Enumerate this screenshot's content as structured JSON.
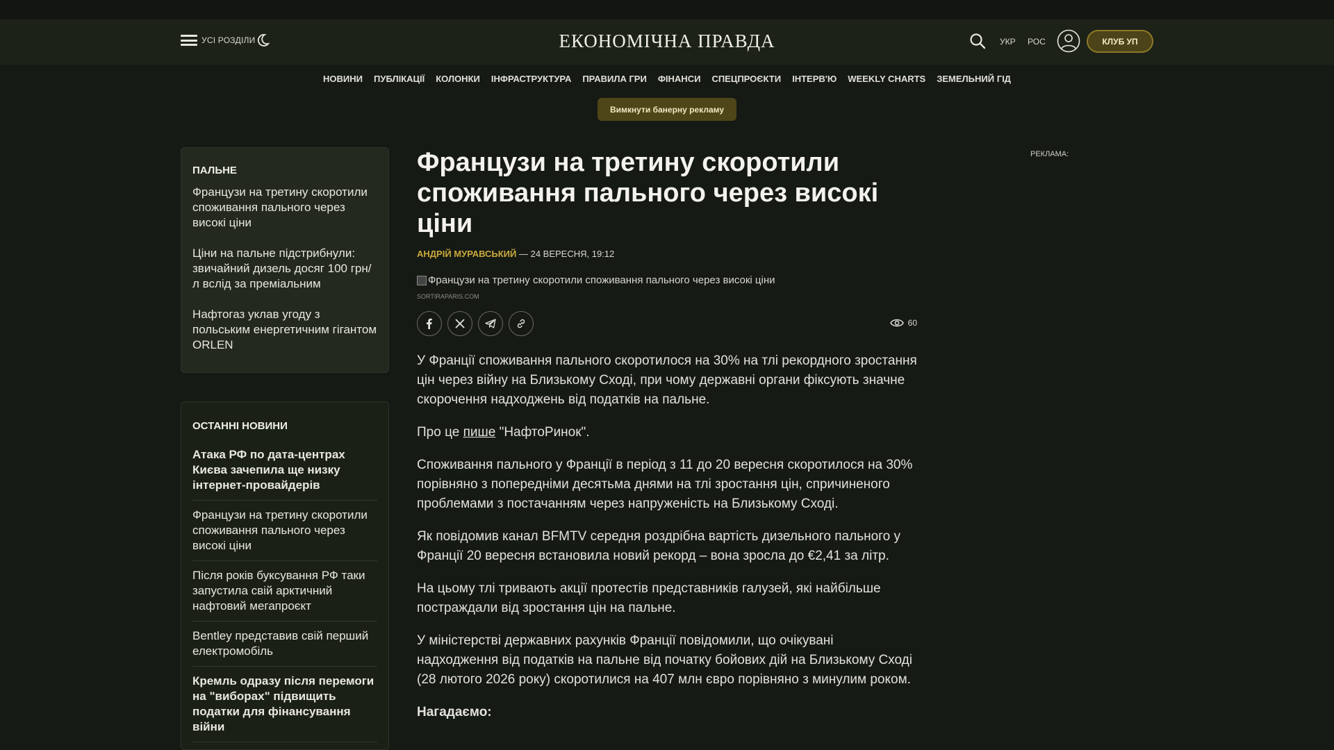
{
  "header": {
    "menu_label": "УСІ РОЗДІЛИ",
    "logo": "ЕКОНОМІЧНА ПРАВДА",
    "lang_ukr": "УКР",
    "lang_ros": "РОС",
    "club_button": "КЛУБ УП"
  },
  "nav": {
    "items": [
      "НОВИНИ",
      "ПУБЛІКАЦІЇ",
      "КОЛОНКИ",
      "ІНФРАСТРУКТУРА",
      "ПРАВИЛА ГРИ",
      "ФІНАНСИ",
      "СПЕЦПРОЄКТИ",
      "ІНТЕРВ'Ю",
      "WEEKLY CHARTS",
      "ЗЕМЕЛЬНИЙ ГІД"
    ]
  },
  "ad_toggle": "Вимкнути банерну рекламу",
  "fuel_box": {
    "title": "ПАЛЬНЕ",
    "links": [
      "Французи на третину скоротили споживання пального через високі ціни",
      "Ціни на пальне підстрибнули: звичайний дизель досяг 100 грн/л вслід за преміальним",
      "Нафтогаз уклав угоду з польським енергетичним гігантом ORLEN"
    ]
  },
  "latest_box": {
    "title": "ОСТАННІ НОВИНИ",
    "items": [
      "Атака РФ по дата-центрах Києва зачепила ще низку інтернет-провайдерів",
      "Французи на третину скоротили споживання пального через високі ціни",
      "Після років буксування РФ таки запустила свій арктичний нафтовий мегапроєкт",
      "Bentley представив свій перший електромобіль",
      "Кремль одразу після перемоги на \"виборах\" підвищить податки для фінансування війни"
    ]
  },
  "article": {
    "headline": "Французи на третину скоротили споживання пального через високі ціни",
    "author": "АНДРІЙ МУРАВСЬКИЙ",
    "date": " — 24 ВЕРЕСНЯ, 19:12",
    "image_alt": "Французи на третину скоротили споживання пального через високі ціни",
    "image_source": "SORTIRAPARIS.COM",
    "views": "60",
    "p1": "У Франції споживання пального скоротилося на 30% на тлі рекордного зростання цін через війну на Близькому Сході, при чому державні органи фіксують значне скорочення надходжень від податків на пальне.",
    "p2_before": "Про це ",
    "p2_link": "пише",
    "p2_after": " \"НафтоРинок\".",
    "p3": "Споживання пального у Франції в період з 11 до 20 вересня скоротилося на 30% порівняно з попередніми десятьма днями на тлі зростання цін, спричиненого проблемами з постачанням через напруженість на Близькому Сході.",
    "p4": "Як повідомив канал BFMTV середня роздрібна вартість дизельного пального у Франції 20 вересня встановила новий рекорд – вона зросла до €2,41 за літр.",
    "p5": "На цьому тлі тривають акції протестів представників галузей, які найбільше постраждали від зростання цін на пальне.",
    "p6": "У міністерстві державних рахунків Франції повідомили, що очікувані надходження від податків на пальне від початку бойових дій на Близькому Сході (28 лютого 2026 року) скоротилися на 407 млн євро порівняно з минулим роком.",
    "p7": "Нагадаємо:"
  },
  "ad_label": "РЕКЛАМА:",
  "colors": {
    "background": "#161a14",
    "header": "#1d2219",
    "accent_gold": "#c9a93c",
    "button_bg": "#4e4519"
  },
  "icons": [
    "menu-icon",
    "moon-icon",
    "search-icon",
    "user-icon",
    "facebook-icon",
    "x-icon",
    "telegram-icon",
    "link-icon",
    "eye-icon"
  ]
}
